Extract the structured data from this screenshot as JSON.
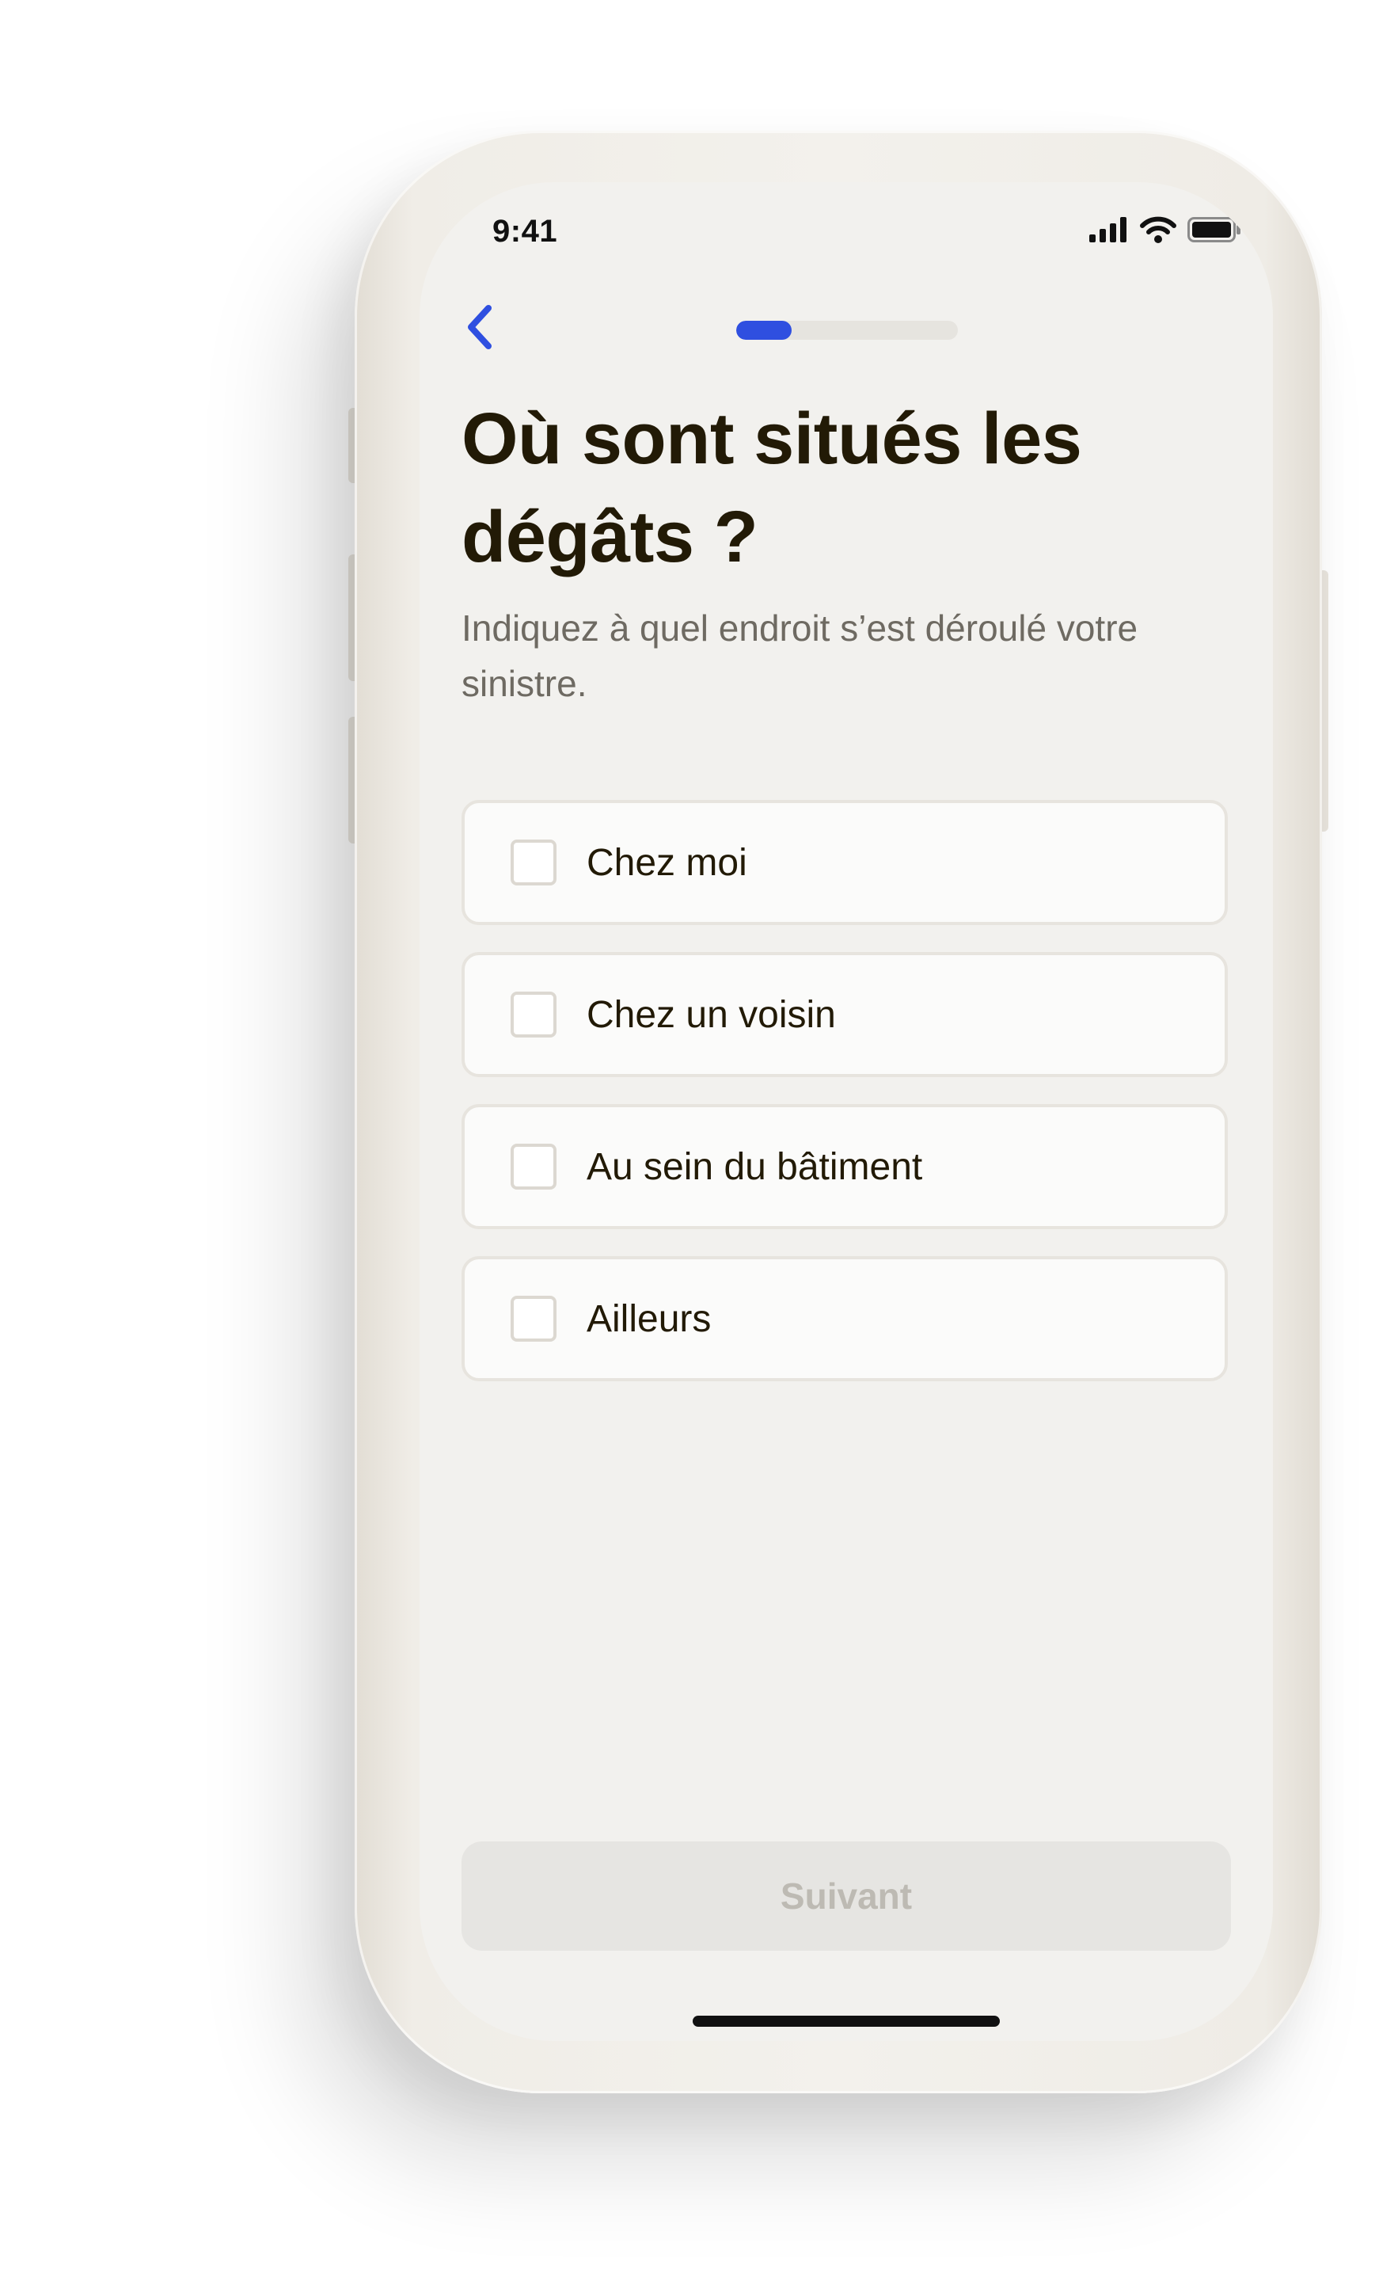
{
  "status_bar": {
    "time": "9:41",
    "signal_icon": "cellular-signal-icon",
    "wifi_icon": "wifi-icon",
    "battery_icon": "battery-icon"
  },
  "nav": {
    "back_icon": "chevron-left-icon",
    "progress_fraction": 0.25,
    "accent_color": "#2f4fe0"
  },
  "question": {
    "title": "Où sont situés les dégâts ?",
    "subtitle": "Indiquez à quel endroit s’est déroulé votre sinistre."
  },
  "options": [
    {
      "label": "Chez moi",
      "checked": false
    },
    {
      "label": "Chez un voisin",
      "checked": false
    },
    {
      "label": "Au sein du bâtiment",
      "checked": false
    },
    {
      "label": "Ailleurs",
      "checked": false
    }
  ],
  "footer": {
    "next_label": "Suivant",
    "next_enabled": false
  }
}
